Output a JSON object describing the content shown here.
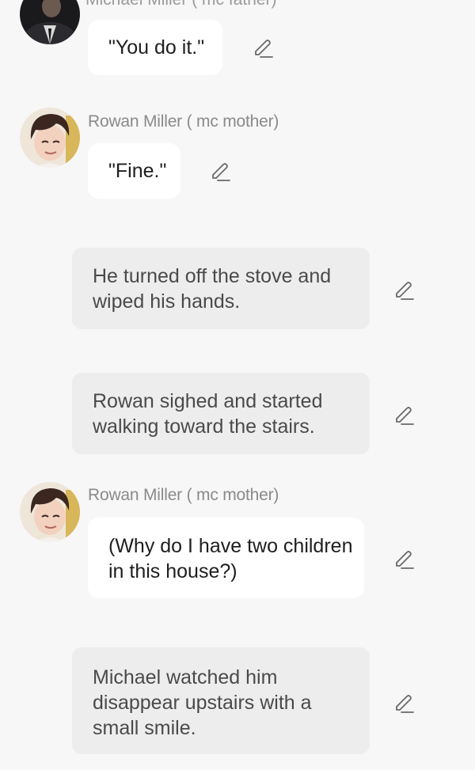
{
  "top_speaker_cut": "Michael Miller ( mc father)",
  "messages": [
    {
      "type": "character",
      "speaker": "Michael Miller ( mc father)",
      "text": "\"You do it.\"",
      "avatar": "dark-haired-man-in-suit"
    },
    {
      "type": "character",
      "speaker": "Rowan Miller ( mc mother)",
      "text": "\"Fine.\"",
      "avatar": "brown-haired-smiling-man"
    },
    {
      "type": "narration",
      "text": "He turned off the stove and wiped his hands."
    },
    {
      "type": "narration",
      "text": "Rowan sighed and started walking toward the stairs."
    },
    {
      "type": "character",
      "speaker": "Rowan Miller ( mc mother)",
      "text": "(Why do I have two children in this house?)",
      "avatar": "brown-haired-smiling-man"
    },
    {
      "type": "narration",
      "text": "Michael watched him disappear upstairs with a small smile."
    }
  ],
  "icons": {
    "edit": "pencil-edit-icon"
  },
  "colors": {
    "background": "#f7f7f7",
    "character_bubble": "#ffffff",
    "narration_bubble": "#ededed",
    "speaker_text": "#8a8a8a"
  }
}
